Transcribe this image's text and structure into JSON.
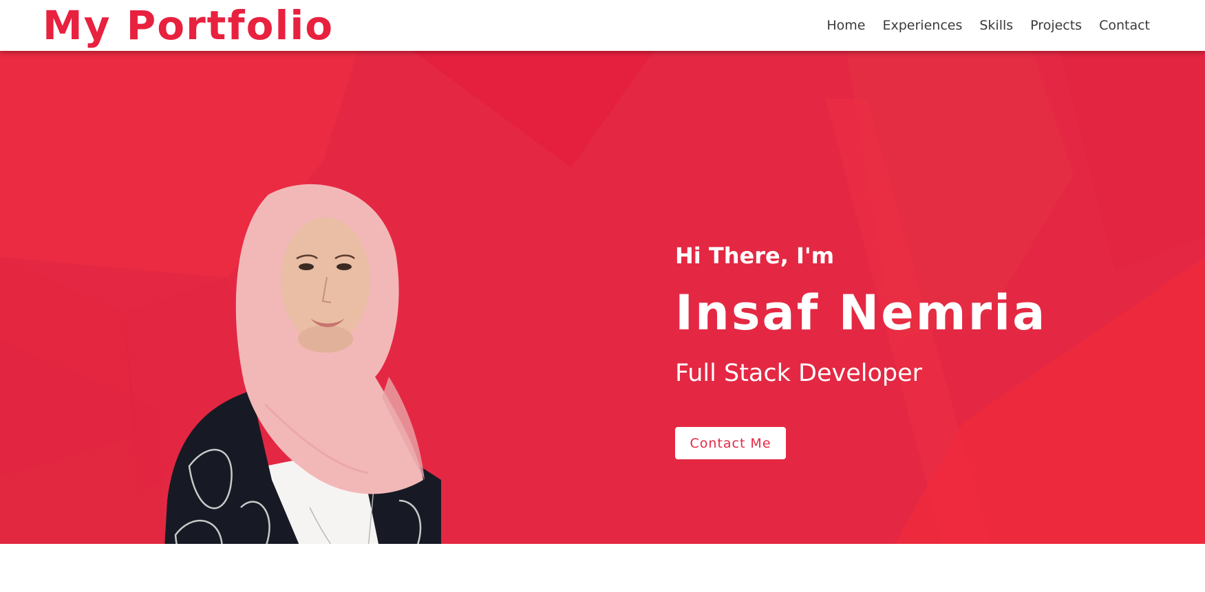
{
  "header": {
    "brand": "My Portfolio",
    "nav": [
      "Home",
      "Experiences",
      "Skills",
      "Projects",
      "Contact"
    ]
  },
  "hero": {
    "greeting": "Hi There, I'm",
    "name": "Insaf Nemria",
    "role": "Full Stack Developer",
    "cta_label": "Contact Me"
  },
  "colors": {
    "accent": "#e8213f",
    "hero_bg": "#e42843",
    "nav_text": "#3a3a3a",
    "white": "#ffffff"
  },
  "icons": {
    "photo": "profile-photo"
  }
}
